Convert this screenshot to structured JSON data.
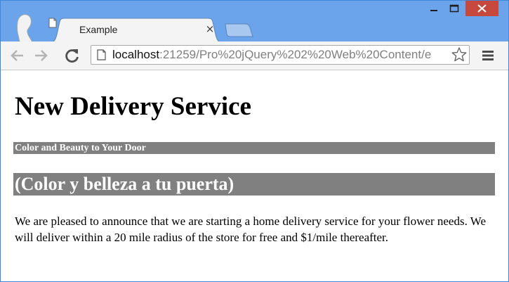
{
  "browser": {
    "tab": {
      "title": "Example",
      "close_glyph": "×",
      "favicon": "page-icon"
    },
    "window_controls": {
      "minimize": "–",
      "maximize": "□",
      "close": "✕"
    },
    "toolbar": {
      "back_icon": "back-arrow-icon",
      "forward_icon": "forward-arrow-icon",
      "reload_icon": "reload-icon",
      "url_host": "localhost",
      "url_rest": ":21259/Pro%20jQuery%202%20Web%20Content/e",
      "bookmark_icon": "star-icon",
      "menu_icon": "menu-icon"
    },
    "colors": {
      "frame": "#6ba4ea",
      "close_button": "#c7483d",
      "heading_bar": "#808080"
    }
  },
  "page": {
    "heading": "New Delivery Service",
    "tagline": "Color and Beauty to Your Door",
    "tagline_es": "(Color y belleza a tu puerta)",
    "paragraph": "We are pleased to announce that we are starting a home delivery service for your flower needs. We will deliver within a 20 mile radius of the store for free and $1/mile thereafter."
  }
}
